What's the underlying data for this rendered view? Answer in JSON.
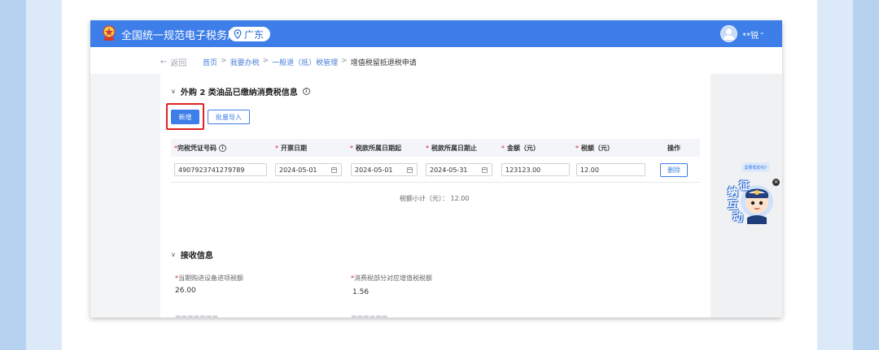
{
  "header": {
    "site_title": "全国统一规范电子税务局",
    "region": "广东",
    "user_name": "**锐",
    "user_caret": "⌄"
  },
  "nav": {
    "back_label": "返回",
    "back_arrow": "←",
    "breadcrumb": [
      "首页",
      "我要办税",
      "一般退（抵）税管理",
      "增值税留抵退税申请"
    ],
    "separator": ">"
  },
  "section1": {
    "title": "外购 2 类油品已缴纳消费税信息",
    "add_button": "新增",
    "import_button": "批量导入",
    "columns": [
      {
        "label": "完税凭证号码",
        "required": true,
        "info": true
      },
      {
        "label": "开票日期",
        "required": true
      },
      {
        "label": "税款所属日期起",
        "required": true
      },
      {
        "label": "税款所属日期止",
        "required": true
      },
      {
        "label": "金额（元）",
        "required": true
      },
      {
        "label": "税额（元）",
        "required": true
      },
      {
        "label": "操作",
        "required": false
      }
    ],
    "rows": [
      {
        "voucher_no": "4907923741279789",
        "invoice_date": "2024-05-01",
        "period_start": "2024-05-01",
        "period_end": "2024-05-31",
        "amount": "123123.00",
        "tax": "12.00",
        "action": "删除"
      }
    ],
    "subtotal": "税额小计（元）：  12.00"
  },
  "section2": {
    "title": "接收信息",
    "fields": [
      {
        "label": "当期购进设备进项税额",
        "value": "26.00"
      },
      {
        "label": "消费税部分对应增值税税额",
        "value": "1.56"
      }
    ]
  },
  "chat": {
    "bubble": "需要帮助吗?",
    "chars": [
      "征",
      "纳",
      "互",
      "动"
    ],
    "close": "×"
  },
  "colors": {
    "primary": "#3d7ee9",
    "highlight": "#e0231f"
  }
}
